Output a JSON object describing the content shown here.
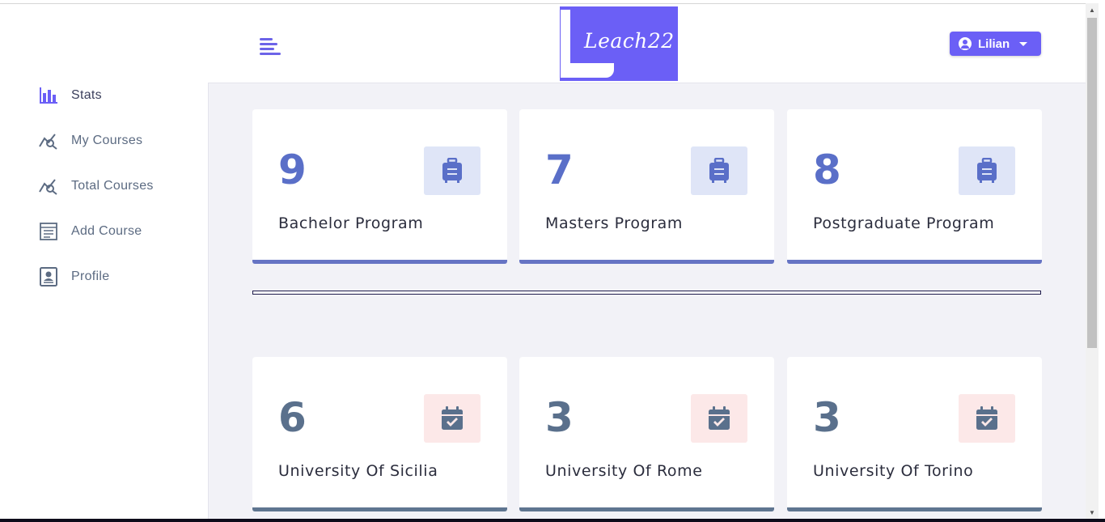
{
  "header": {
    "logo_text": "Leach22",
    "user": {
      "name": "Lilian"
    }
  },
  "sidebar": {
    "items": [
      {
        "label": "Stats",
        "icon": "bar-chart-icon"
      },
      {
        "label": "My Courses",
        "icon": "chart-search-icon"
      },
      {
        "label": "Total Courses",
        "icon": "chart-search-icon"
      },
      {
        "label": "Add Course",
        "icon": "form-icon"
      },
      {
        "label": "Profile",
        "icon": "id-card-icon"
      }
    ]
  },
  "programs": [
    {
      "count": "9",
      "label": "Bachelor Program",
      "icon": "suitcase-icon"
    },
    {
      "count": "7",
      "label": "Masters Program",
      "icon": "suitcase-icon"
    },
    {
      "count": "8",
      "label": "Postgraduate Program",
      "icon": "suitcase-icon"
    }
  ],
  "universities": [
    {
      "count": "6",
      "label": "University Of Sicilia",
      "icon": "calendar-check-icon"
    },
    {
      "count": "3",
      "label": "University Of Rome",
      "icon": "calendar-check-icon"
    },
    {
      "count": "3",
      "label": "University Of Torino",
      "icon": "calendar-check-icon"
    }
  ],
  "colors": {
    "accent": "#6b5ff6",
    "program_number": "#5a6fc8",
    "program_icon_bg": "#dfe5f7",
    "program_bar": "#6674c4",
    "university_number": "#5a708c",
    "university_icon_bg": "#fce8e8",
    "university_bar": "#5f7590"
  }
}
